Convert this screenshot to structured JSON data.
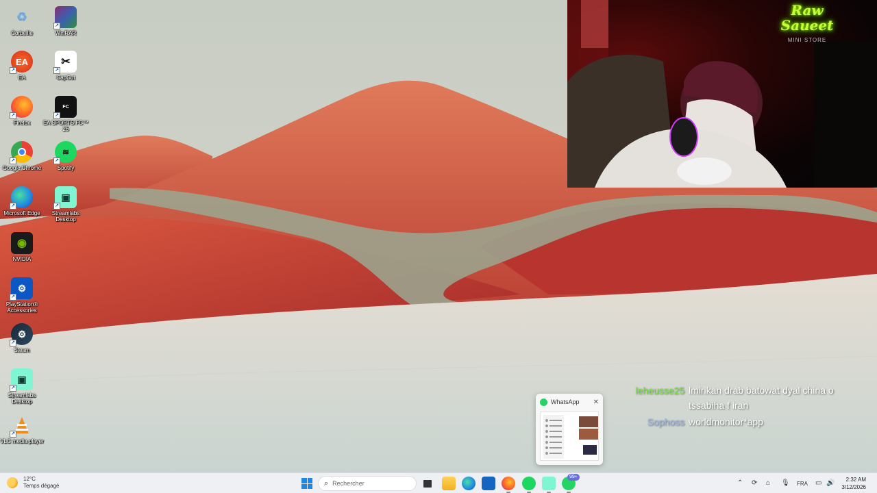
{
  "desktop": {
    "icons": [
      {
        "label": "Corbeille",
        "icon": "recycle-bin-icon"
      },
      {
        "label": "WinRAR",
        "icon": "winrar-icon"
      },
      {
        "label": "EA",
        "icon": "ea-icon"
      },
      {
        "label": "CapCut",
        "icon": "capcut-icon"
      },
      {
        "label": "Firefox",
        "icon": "firefox-icon"
      },
      {
        "label": "EA SPORTS FC™ 26",
        "icon": "ea-sports-fc-icon"
      },
      {
        "label": "Google Chrome",
        "icon": "chrome-icon"
      },
      {
        "label": "Spotify",
        "icon": "spotify-icon"
      },
      {
        "label": "Microsoft Edge",
        "icon": "edge-icon"
      },
      {
        "label": "Streamlabs Desktop",
        "icon": "streamlabs-icon"
      },
      {
        "label": "NVIDIA",
        "icon": "nvidia-icon"
      },
      {
        "label": "PlayStation® Accessories",
        "icon": "playstation-accessories-icon"
      },
      {
        "label": "Steam",
        "icon": "steam-icon"
      },
      {
        "label": "Streamlabs Desktop",
        "icon": "streamlabs-icon"
      },
      {
        "label": "VLC media player",
        "icon": "vlc-icon"
      }
    ]
  },
  "webcam": {
    "neon_sign_main": "Raw Saueet",
    "neon_sign_sub": "MINI STORE"
  },
  "whatsapp_preview": {
    "title": "WhatsApp",
    "close": "✕"
  },
  "chat": [
    {
      "user": "leheusse25",
      "user_color": "#7ee84a",
      "message_line1": "lmirikan drab batowat dyal china o",
      "message_line2": "tssabiha f iran"
    },
    {
      "user": "Sophoss",
      "user_color": "#9fb7e8",
      "message_line1": "worldmonitor*app"
    }
  ],
  "taskbar": {
    "weather_temp": "12°C",
    "weather_desc": "Temps dégagé",
    "search_placeholder": "Rechercher",
    "apps": [
      "task-view-icon",
      "file-explorer-icon",
      "edge-icon",
      "store-icon",
      "firefox-icon",
      "spotify-icon",
      "streamlabs-icon",
      "whatsapp-icon"
    ],
    "whatsapp_badge": "99+",
    "language": "FRA",
    "time": "2:32 AM",
    "date": "3/12/2026"
  },
  "colors": {
    "accent": "#1e88e5",
    "taskbar_bg": "#eef0f4",
    "neon": "#c9ff3a"
  }
}
